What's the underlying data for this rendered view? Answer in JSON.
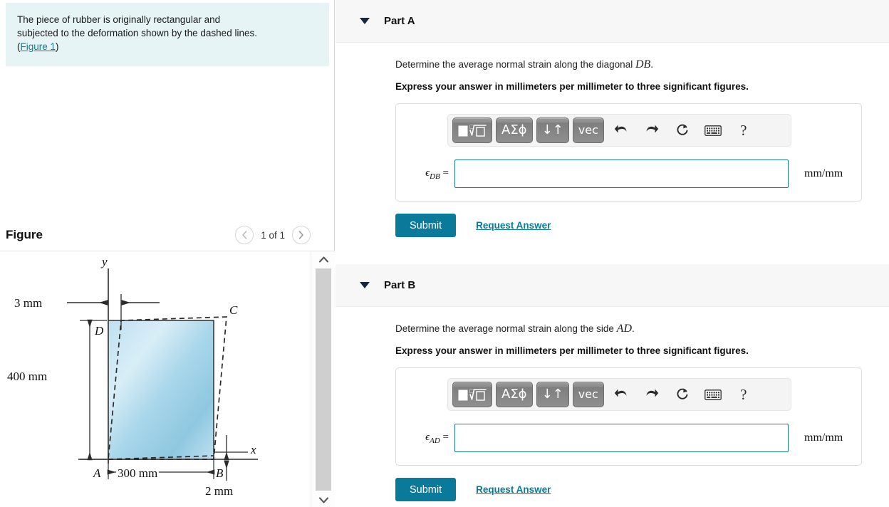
{
  "problem": {
    "line1": "The piece of rubber is originally rectangular and",
    "line2": "subjected to the deformation shown by the dashed lines.",
    "paren_open": "(",
    "figure_link": "Figure 1",
    "paren_close": ")"
  },
  "figure": {
    "title": "Figure",
    "pager_label": "1 of 1",
    "prev_icon": "chevron-left-icon",
    "next_icon": "chevron-right-icon",
    "scroll_up_icon": "chevron-up-icon",
    "scroll_down_icon": "chevron-down-icon",
    "labels": {
      "y_axis": "y",
      "x_axis": "x",
      "point_a": "A",
      "point_b": "B",
      "point_c": "C",
      "point_d": "D",
      "dim_top": "3 mm",
      "dim_left": "400 mm",
      "dim_bottom": "300 mm",
      "dim_right": "2 mm"
    },
    "colors": {
      "fill_light": "#cfe7f2",
      "fill_mid": "#8ec8e0",
      "outline": "#3a3a3a"
    }
  },
  "parts": [
    {
      "caret_icon": "caret-down-icon",
      "title": "Part A",
      "prompt_prefix": "Determine the average normal strain along the diagonal ",
      "prompt_var": "DB",
      "prompt_suffix": ".",
      "instruction": "Express your answer in millimeters per millimeter to three significant figures.",
      "toolbar": {
        "template_label": "√",
        "greek_label": "ΑΣϕ",
        "arrows_label": "↓↑",
        "vec_label": "vec",
        "undo_icon": "undo-arrow-icon",
        "redo_icon": "redo-arrow-icon",
        "reset_icon": "reset-circular-arrow-icon",
        "keyboard_icon": "keyboard-icon",
        "help_label": "?"
      },
      "variable_symbol": "ϵ",
      "variable_subscript": "DB",
      "equals": "=",
      "input_value": "",
      "input_placeholder": "",
      "unit": "mm/mm",
      "submit_label": "Submit",
      "request_label": "Request Answer"
    },
    {
      "caret_icon": "caret-down-icon",
      "title": "Part B",
      "prompt_prefix": "Determine the average normal strain along the side ",
      "prompt_var": "AD",
      "prompt_suffix": ".",
      "instruction": "Express your answer in millimeters per millimeter to three significant figures.",
      "toolbar": {
        "template_label": "√",
        "greek_label": "ΑΣϕ",
        "arrows_label": "↓↑",
        "vec_label": "vec",
        "undo_icon": "undo-arrow-icon",
        "redo_icon": "redo-arrow-icon",
        "reset_icon": "reset-circular-arrow-icon",
        "keyboard_icon": "keyboard-icon",
        "help_label": "?"
      },
      "variable_symbol": "ϵ",
      "variable_subscript": "AD",
      "equals": "=",
      "input_value": "",
      "input_placeholder": "",
      "unit": "mm/mm",
      "submit_label": "Submit",
      "request_label": "Request Answer"
    }
  ]
}
